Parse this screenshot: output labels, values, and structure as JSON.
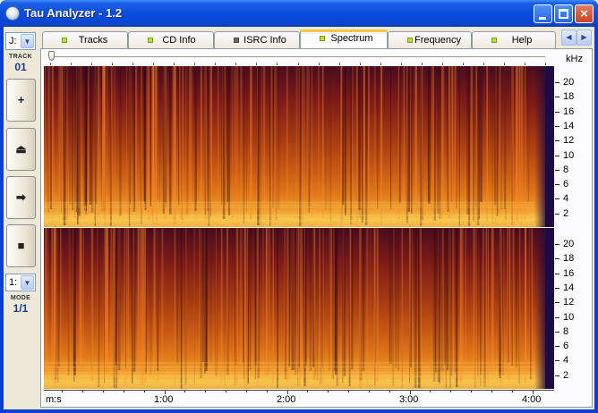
{
  "window": {
    "title": "Tau Analyzer - 1.2"
  },
  "titlebar_buttons": {
    "minimize": "minimize",
    "maximize": "maximize",
    "close": "×"
  },
  "left": {
    "drive_value": "J:",
    "track_label": "TRACK",
    "track_value": "01",
    "mode_value": "1:",
    "mode_label": "MODE",
    "mode_ratio": "1/1",
    "buttons": [
      {
        "name": "add-button",
        "glyph": "+"
      },
      {
        "name": "eject-button",
        "glyph": "⏏"
      },
      {
        "name": "play-button",
        "glyph": "➡"
      },
      {
        "name": "stop-button",
        "glyph": "■"
      }
    ]
  },
  "tabs": [
    {
      "id": "tracks",
      "label": "Tracks",
      "dot": "green"
    },
    {
      "id": "cd-info",
      "label": "CD Info",
      "dot": "green"
    },
    {
      "id": "isrc-info",
      "label": "ISRC Info",
      "dot": "gray"
    },
    {
      "id": "spectrum",
      "label": "Spectrum",
      "dot": "green",
      "active": true
    },
    {
      "id": "frequency",
      "label": "Frequency",
      "dot": "green"
    },
    {
      "id": "help",
      "label": "Help",
      "dot": "green"
    }
  ],
  "scroll": {
    "left": "◀",
    "right": "▶"
  },
  "spectrum": {
    "y_unit": "kHz",
    "y_ticks": [
      "20",
      "18",
      "16",
      "14",
      "12",
      "10",
      "8",
      "6",
      "4",
      "2"
    ],
    "x_unit": "m:s",
    "x_ticks": [
      "1:00",
      "2:00",
      "3:00",
      "4:00"
    ],
    "colors": {
      "high": "#f7c44a",
      "mid": "#c85a14",
      "low": "#4a0c1e",
      "edge": "#1d0b45"
    }
  }
}
